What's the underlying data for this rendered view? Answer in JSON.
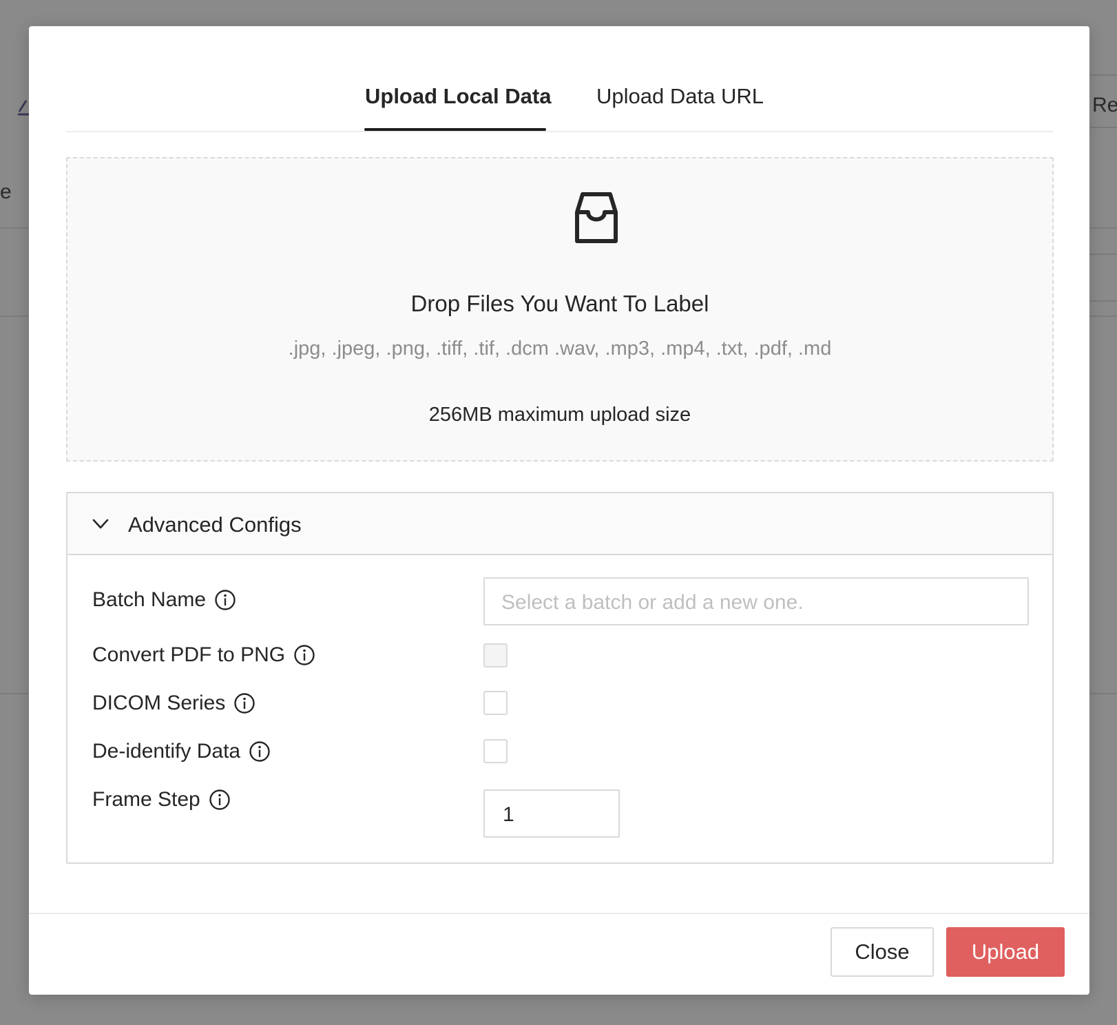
{
  "background": {
    "fragment_left": "e",
    "fragment_right": "Re"
  },
  "tabs": [
    {
      "label": "Upload Local Data",
      "active": true
    },
    {
      "label": "Upload Data URL",
      "active": false
    }
  ],
  "dropzone": {
    "icon": "inbox-icon",
    "title": "Drop Files You Want To Label",
    "formats": ".jpg, .jpeg, .png, .tiff, .tif, .dcm .wav, .mp3, .mp4, .txt, .pdf, .md",
    "size_note": "256MB maximum upload size"
  },
  "advanced": {
    "title": "Advanced Configs",
    "expanded": true,
    "fields": {
      "batch_name": {
        "label": "Batch Name",
        "placeholder": "Select a batch or add a new one."
      },
      "convert_pdf": {
        "label": "Convert PDF to PNG",
        "checked": false,
        "disabled": true
      },
      "dicom_series": {
        "label": "DICOM Series",
        "checked": false
      },
      "deidentify": {
        "label": "De-identify Data",
        "checked": false
      },
      "frame_step": {
        "label": "Frame Step",
        "value": "1"
      }
    }
  },
  "footer": {
    "close_label": "Close",
    "upload_label": "Upload"
  },
  "colors": {
    "primary": "#e06060",
    "backdrop": "#8a8a8a"
  }
}
